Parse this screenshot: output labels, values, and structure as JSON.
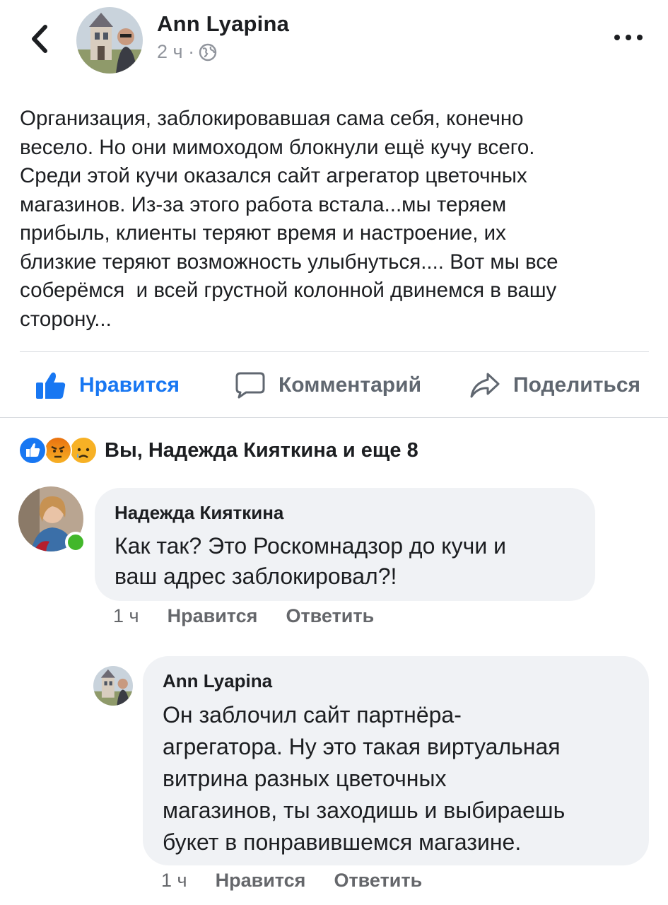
{
  "header": {
    "author": "Ann Lyapina",
    "time": "2 ч ·",
    "back_icon": "chevron-left-icon",
    "privacy_icon": "globe-icon",
    "more_icon": "ellipsis-icon"
  },
  "post": {
    "text": "Организация, заблокировавшая сама себя, конечно\nвесело. Но они мимоходом блокнули ещё кучу всего.\nСреди этой кучи оказался сайт агрегатор цветочных\nмагазинов. Из-за этого работа встала...мы теряем\nприбыль, клиенты теряют время и настроение, их\nблизкие теряют возможность улыбнуться.... Вот мы все\nсоберёмся  и всей грустной колонной двинемся в вашу\nсторону..."
  },
  "actions": {
    "like": "Нравится",
    "comment": "Комментарий",
    "share": "Поделиться"
  },
  "reactions": {
    "summary": "Вы, Надежда Кияткина и еще 8",
    "types": [
      "like",
      "angry",
      "sad"
    ],
    "colors": {
      "like": "#1877f2",
      "angry": "#e9710f",
      "sad": "#f7b125"
    }
  },
  "comments": [
    {
      "author": "Надежда Кияткина",
      "text": "Как так? Это Роскомнадзор до кучи и\nваш адрес заблокировал?!",
      "time": "1 ч",
      "like": "Нравится",
      "reply": "Ответить",
      "online": true
    },
    {
      "author": "Ann Lyapina",
      "text": "Он заблочил сайт партнёра-\nагрегатора. Ну это такая виртуальная\nвитрина разных цветочных\nмагазинов, ты заходишь и выбираешь\nбукет в понравившемся магазине.",
      "time": "1 ч",
      "like": "Нравится",
      "reply": "Ответить"
    }
  ],
  "colors": {
    "accent": "#1877f2",
    "bubble": "#f0f2f5",
    "muted": "#65676b",
    "online": "#42b72a"
  }
}
